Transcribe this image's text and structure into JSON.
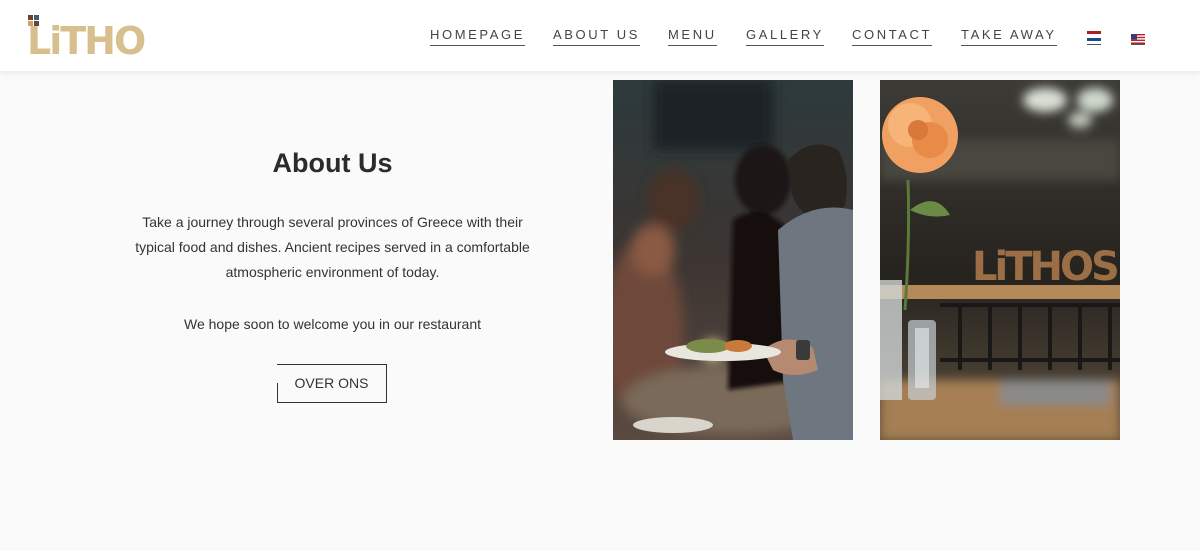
{
  "brand": {
    "logo_text": "LiTHOS",
    "logo_color": "#d8bf8e"
  },
  "nav": {
    "items": [
      {
        "label": "HOMEPAGE"
      },
      {
        "label": "ABOUT US"
      },
      {
        "label": "MENU"
      },
      {
        "label": "GALLERY"
      },
      {
        "label": "CONTACT"
      },
      {
        "label": "TAKE AWAY"
      }
    ],
    "languages": [
      "dutch-flag-icon",
      "us-flag-icon"
    ]
  },
  "about": {
    "title": "About Us",
    "paragraph1": "Take a journey through several provinces of Greece with their typical food and dishes. Ancient recipes served in a comfortable atmospheric environment of today.",
    "paragraph2": "We hope soon to welcome you in our restaurant",
    "button_label": "OVER ONS"
  },
  "photos": {
    "photo2_sign_text": "LiTHOS"
  }
}
